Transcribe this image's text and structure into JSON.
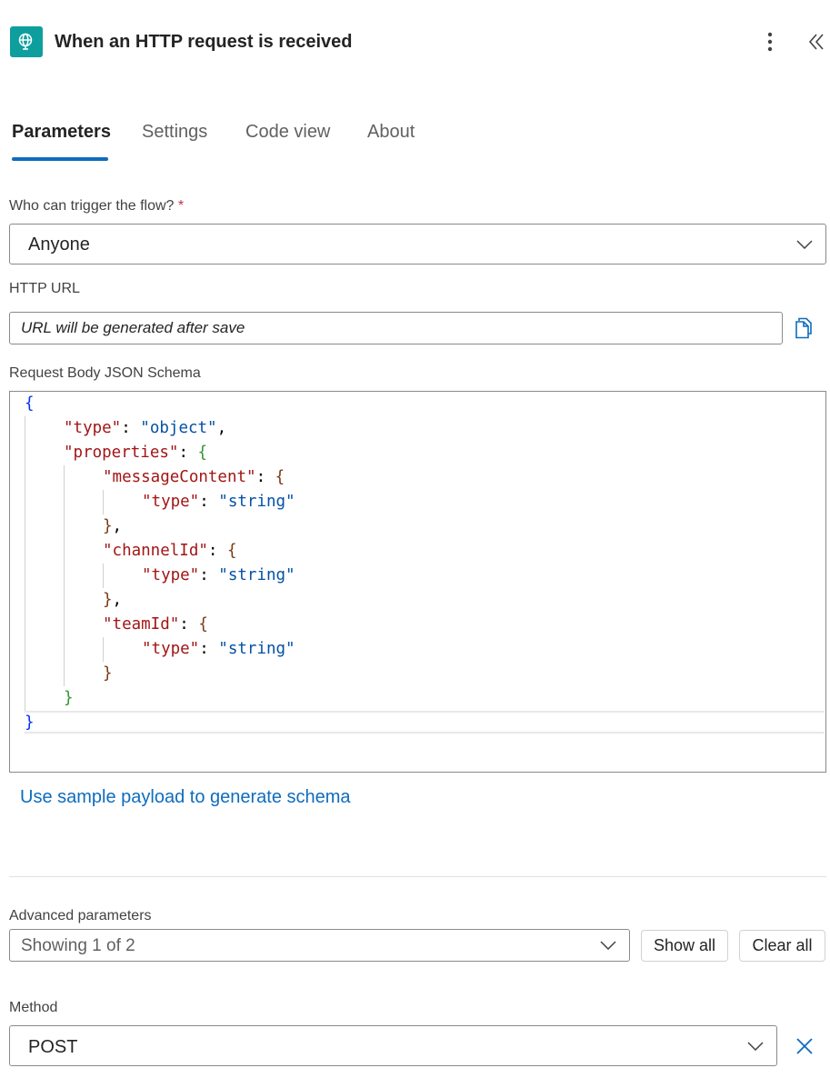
{
  "header": {
    "title": "When an HTTP request is received",
    "icon": "http-request-trigger-icon",
    "accent": "#0f9e9e"
  },
  "tabs": [
    {
      "label": "Parameters",
      "active": true
    },
    {
      "label": "Settings",
      "active": false
    },
    {
      "label": "Code view",
      "active": false
    },
    {
      "label": "About",
      "active": false
    }
  ],
  "trigger": {
    "label": "Who can trigger the flow?",
    "required_marker": "*",
    "value": "Anyone"
  },
  "http_url": {
    "label": "HTTP URL",
    "placeholder": "URL will be generated after save"
  },
  "schema": {
    "label": "Request Body JSON Schema",
    "lines": [
      "{",
      "\"type\": \"object\",",
      "\"properties\": {",
      "\"messageContent\": {",
      "\"type\": \"string\"",
      "},",
      "\"channelId\": {",
      "\"type\": \"string\"",
      "},",
      "\"teamId\": {",
      "\"type\": \"string\"",
      "}",
      "}",
      "}"
    ]
  },
  "sample_link": "Use sample payload to generate schema",
  "advanced": {
    "label": "Advanced parameters",
    "value": "Showing 1 of 2",
    "show_all": "Show all",
    "clear_all": "Clear all"
  },
  "method": {
    "label": "Method",
    "value": "POST"
  },
  "colors": {
    "link": "#0f6cbd",
    "tab_indicator": "#0f6cbd",
    "required": "#c4314b"
  }
}
